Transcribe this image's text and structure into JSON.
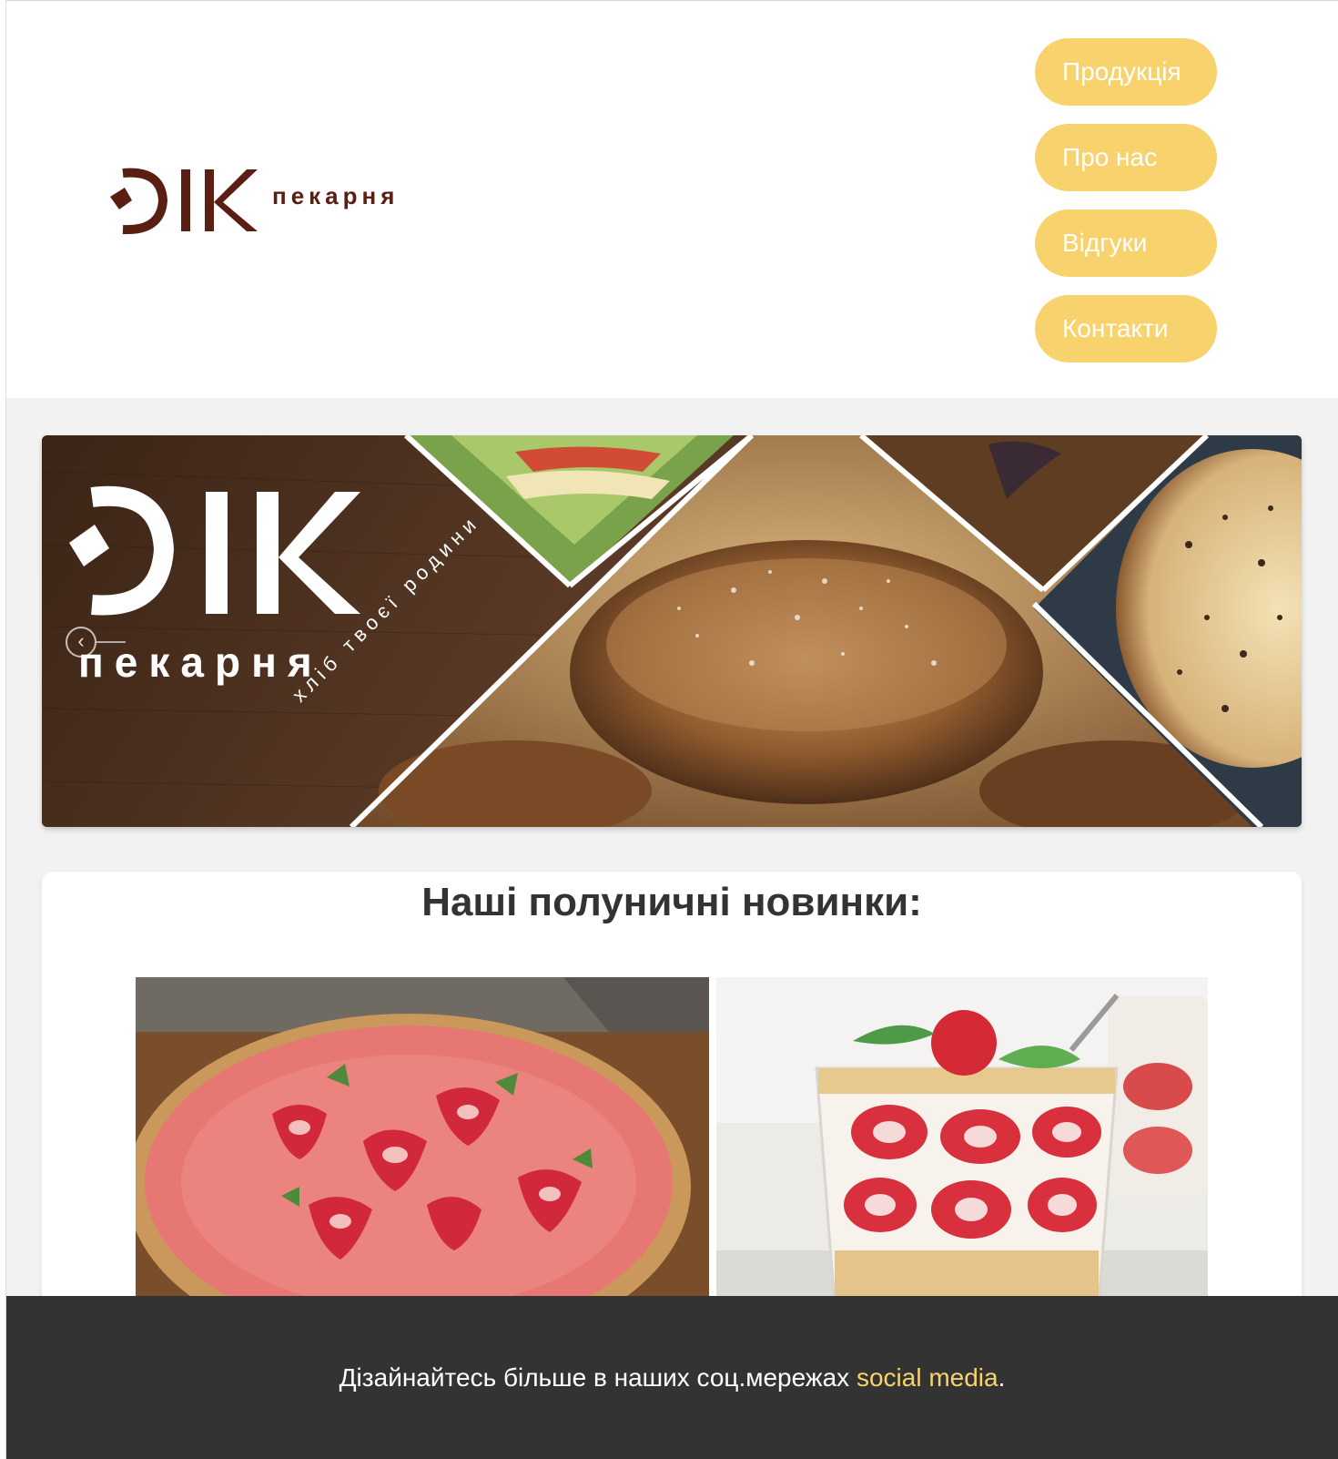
{
  "header": {
    "logo": {
      "letters": "ƆІК",
      "word": "пекарня"
    }
  },
  "nav": [
    {
      "label": "Продукція"
    },
    {
      "label": "Про нас"
    },
    {
      "label": "Відгуки"
    },
    {
      "label": "Контакти"
    }
  ],
  "banner": {
    "logo_letters": "ƆІК",
    "logo_word": "пекарня",
    "slogan": "хліб твоєї родини",
    "prev_icon": "chevron-left-icon"
  },
  "news": {
    "title": "Наші полуничні новинки:",
    "photos": [
      {
        "subject": "strawberry-tart"
      },
      {
        "subject": "strawberry-trifle"
      }
    ]
  },
  "footer": {
    "text": "Дізайнайтесь більше в наших соц.мережах ",
    "link": "social media",
    "end": "."
  },
  "colors": {
    "accent": "#f8d26d",
    "logo_brown": "#5a1e12",
    "footer_bg": "#333333",
    "page_bg": "#f2f2f2"
  }
}
